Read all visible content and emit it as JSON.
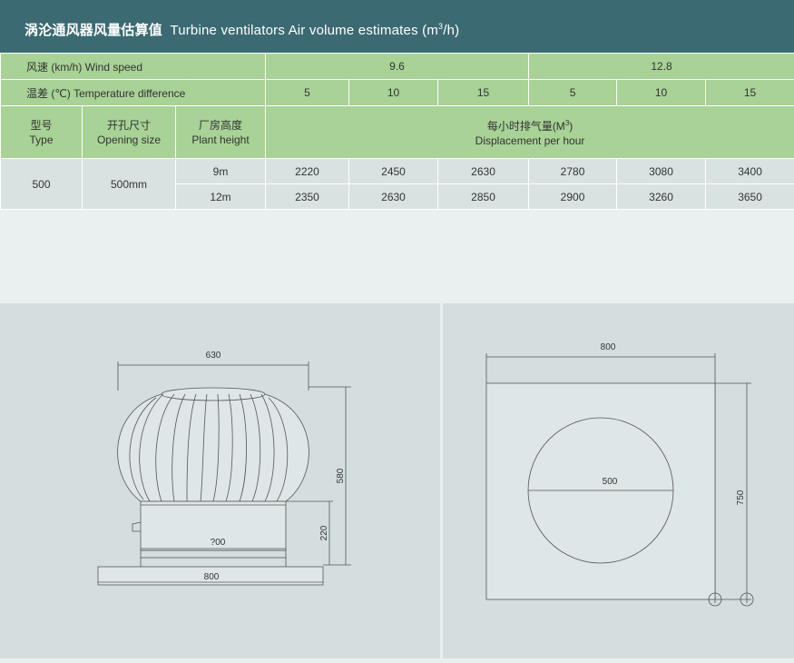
{
  "title": {
    "cn": "涡沦通风器风量估算值",
    "en_prefix": "Turbine ventilators Air volume estimates",
    "unit_open": "(m",
    "unit_sup": "3",
    "unit_close": "/h)"
  },
  "rows": {
    "wind_label": "风速 (km/h)  Wind speed",
    "wind_values": [
      "9.6",
      "12.8"
    ],
    "temp_label": "温差 (℃)  Temperature difference",
    "temp_values": [
      "5",
      "10",
      "15",
      "5",
      "10",
      "15"
    ]
  },
  "headers": {
    "type_cn": "型号",
    "type_en": "Type",
    "opening_cn": "开孔尺寸",
    "opening_en": "Opening size",
    "height_cn": "厂房高度",
    "height_en": "Plant height",
    "displacement_cn": "每小时排气量(M",
    "displacement_sup": "3",
    "displacement_close": ")",
    "displacement_en": "Displacement per hour"
  },
  "data": {
    "type": "500",
    "opening": "500mm",
    "rows": [
      {
        "height": "9m",
        "values": [
          "2220",
          "2450",
          "2630",
          "2780",
          "3080",
          "3400"
        ]
      },
      {
        "height": "12m",
        "values": [
          "2350",
          "2630",
          "2850",
          "2900",
          "3260",
          "3650"
        ]
      }
    ]
  },
  "drawing_left": {
    "top_width": "630",
    "total_height": "580",
    "base_height": "220",
    "neck_width": "?00",
    "flange_width": "800"
  },
  "drawing_right": {
    "plate_width": "800",
    "circle_diameter": "500",
    "plate_height": "750"
  },
  "colors": {
    "title_bg": "#3b6a72",
    "header_green": "#a8d296",
    "data_gray": "#d9e2e1",
    "panel_bg": "#d5dedf"
  }
}
